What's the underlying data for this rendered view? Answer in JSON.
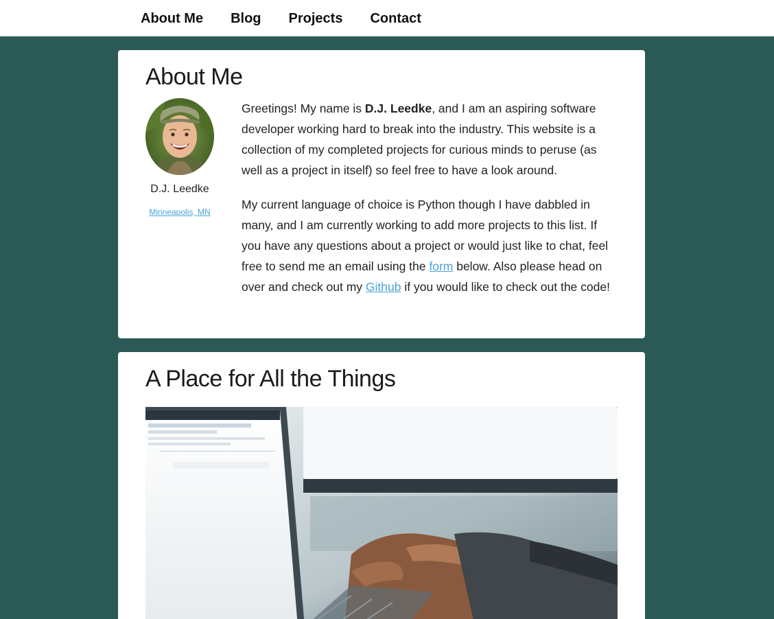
{
  "nav": {
    "items": [
      "About Me",
      "Blog",
      "Projects",
      "Contact"
    ]
  },
  "about": {
    "heading": "About Me",
    "name": "D.J. Leedke",
    "location": "Minneapolis, MN",
    "p1": {
      "before": "Greetings! My name is ",
      "bold": "D.J. Leedke",
      "after": ", and I am an aspiring software developer working hard to break into the industry. This website is a collection of my completed projects for curious minds to peruse (as well as a project in itself) so feel free to have a look around."
    },
    "p2": {
      "t1": "My current language of choice is Python though I have dabbled in many, and I am currently working to add more projects to this list. If you have any questions about a project or would just like to chat, feel free to send me an email using the ",
      "link1": "form",
      "t2": " below. Also please head on over and check out my ",
      "link2": "Github",
      "t3": " if you would like to check out the code!"
    }
  },
  "things": {
    "heading": "A Place for All the Things"
  },
  "colors": {
    "background": "#2b5955",
    "link": "#4aa3d8",
    "card": "#ffffff"
  }
}
